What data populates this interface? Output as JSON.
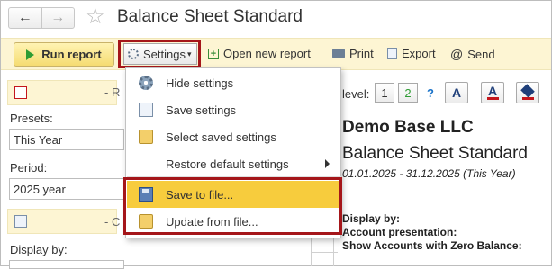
{
  "window": {
    "title": "Balance Sheet Standard",
    "back_glyph": "←",
    "forward_glyph": "→",
    "star_glyph": "☆"
  },
  "toolbar": {
    "run_label": "Run report",
    "settings_label": "Settings",
    "settings_caret": "▾",
    "open_new_label": "Open new report",
    "print_label": "Print",
    "export_label": "Export",
    "send_label": "Send"
  },
  "left_panel": {
    "section1_label": "- R",
    "presets_label": "Presets:",
    "presets_value": "This Year",
    "period_label": "Period:",
    "period_value": "2025 year",
    "section2_label": "- C",
    "display_by_label": "Display by:"
  },
  "level_bar": {
    "label": "level:",
    "level1": "1",
    "level2": "2",
    "help": "?",
    "font_a": "A",
    "color_a": "A"
  },
  "report": {
    "company": "Demo Base LLC",
    "title": "Balance Sheet Standard",
    "period": "01.01.2025 - 31.12.2025 (This Year)",
    "display_by": "Display by:",
    "account_presentation": "Account presentation:",
    "zero_balance": "Show Accounts with Zero Balance:"
  },
  "menu": {
    "items": [
      {
        "label": "Hide settings",
        "icon": "gear-icon"
      },
      {
        "label": "Save settings",
        "icon": "save-settings-icon"
      },
      {
        "label": "Select saved settings",
        "icon": "folder-gear-icon"
      },
      {
        "label": "Restore default settings",
        "icon": "none"
      },
      {
        "label": "Save to file...",
        "icon": "floppy-icon",
        "selected": true
      },
      {
        "label": "Update from file...",
        "icon": "folder-doc-icon"
      }
    ]
  },
  "colors": {
    "accent_yellow": "#fdf5d3",
    "selection": "#f7cc3d",
    "highlight_frame": "#a5161a",
    "run_play": "#2e9c33"
  }
}
